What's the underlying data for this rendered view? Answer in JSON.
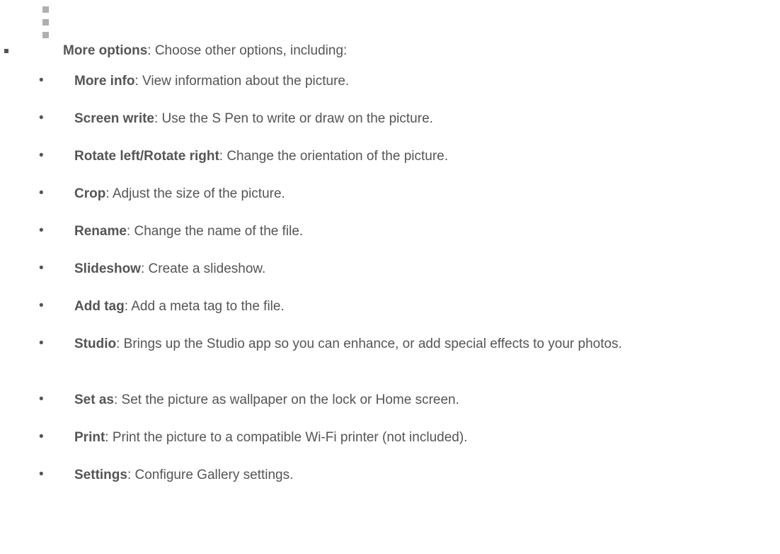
{
  "top_item": {
    "icon": "more-options-icon",
    "term": "More options",
    "description": ": Choose other options, including:"
  },
  "options": [
    {
      "term": "More info",
      "description": ": View information about the picture."
    },
    {
      "term": "Screen write",
      "description": ": Use the S Pen to write or draw on the picture."
    },
    {
      "term": "Rotate left/Rotate right",
      "description": ": Change the orientation of the picture."
    },
    {
      "term": "Crop",
      "description": ": Adjust the size of the picture."
    },
    {
      "term": "Rename",
      "description": ": Change the name of the file."
    },
    {
      "term": "Slideshow",
      "description": ": Create a slideshow."
    },
    {
      "term": "Add tag",
      "description": ": Add a meta tag to the file."
    },
    {
      "term": "Studio",
      "description": ": Brings up the Studio app so you can enhance, or add special effects to your photos."
    },
    {
      "term": "Set as",
      "description": ": Set the picture as wallpaper on the lock or Home screen."
    },
    {
      "term": "Print",
      "description": ": Print the picture to a compatible Wi-Fi printer (not included)."
    },
    {
      "term": "Settings",
      "description": ": Configure Gallery settings."
    }
  ],
  "bullet_symbol": "•"
}
